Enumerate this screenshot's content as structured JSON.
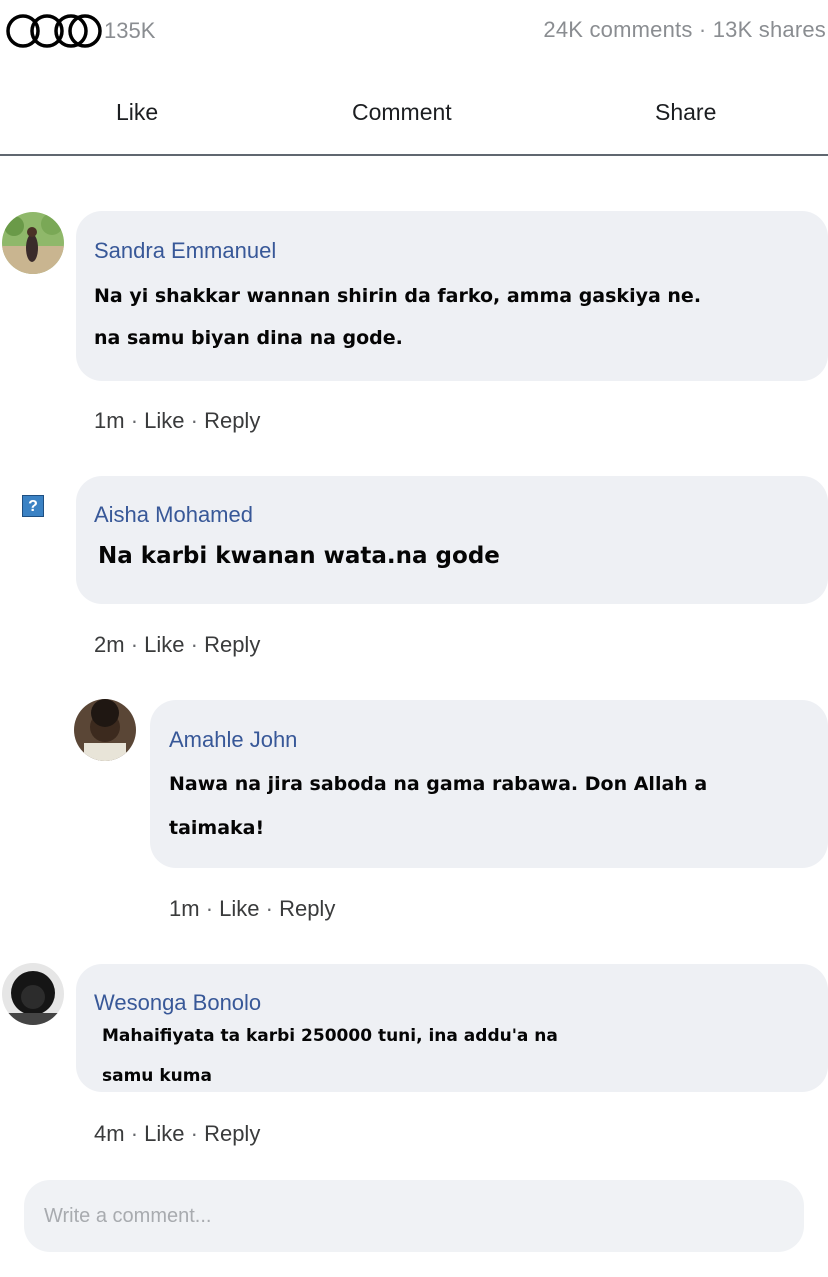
{
  "post_stats": {
    "reaction_count": "135K",
    "engagement": "24K comments · 13K shares",
    "logo_icon": "interlocking-rings-icon"
  },
  "actions": {
    "like": "Like",
    "comment": "Comment",
    "share": "Share"
  },
  "comments": [
    {
      "author": "Sandra Emmanuel",
      "text_lines": [
        "Na yi shakkar wannan shirin da farko, amma gaskiya ne.",
        "na samu biyan dina na gode."
      ],
      "time": "1m",
      "like": "Like",
      "reply": "Reply",
      "sep": "·"
    },
    {
      "author": "Aisha Mohamed",
      "text_lines": [
        "Na karbi kwanan wata.na gode"
      ],
      "time": "2m",
      "like": "Like",
      "reply": "Reply",
      "sep": "·",
      "avatar_icon": "question-mark-icon",
      "avatar_glyph": "?"
    },
    {
      "author": "Amahle John",
      "text_lines": [
        "Nawa na jira saboda na gama rabawa. Don Allah a",
        "taimaka!"
      ],
      "time": "1m",
      "like": "Like",
      "reply": "Reply",
      "sep": "·"
    },
    {
      "author": "Wesonga Bonolo",
      "text_lines": [
        "Mahaifiyata ta karbi 250000 tuni, ina addu'a na",
        "samu kuma"
      ],
      "time": "4m",
      "like": "Like",
      "reply": "Reply",
      "sep": "·"
    }
  ],
  "composer": {
    "placeholder": "Write a comment..."
  },
  "colors": {
    "author_blue": "#385898",
    "bubble_bg": "#eef0f4",
    "muted_text": "#8a8d91"
  }
}
